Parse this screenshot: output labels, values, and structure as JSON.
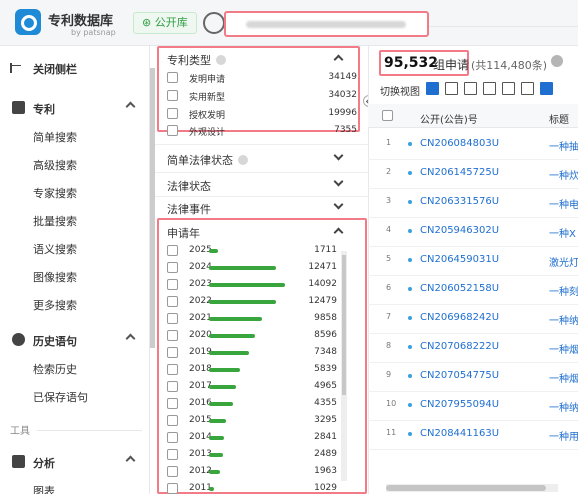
{
  "header": {
    "app_name": "专利数据库",
    "app_sub": "by patsnap",
    "public_button": "公开库"
  },
  "nav": {
    "collapse_label": "关闭侧栏",
    "groups": [
      {
        "label": "专利",
        "items": [
          "简单搜索",
          "高级搜索",
          "专家搜索",
          "批量搜索",
          "语义搜索",
          "图像搜索",
          "更多搜索"
        ]
      },
      {
        "label": "历史语句",
        "items": [
          "检索历史",
          "已保存语句"
        ]
      }
    ],
    "section_label": "工具",
    "analysis_label": "分析",
    "analysis_first": "图表"
  },
  "filters": {
    "patent_type": {
      "title": "专利类型",
      "rows": [
        {
          "label": "发明申请",
          "count": "34149"
        },
        {
          "label": "实用新型",
          "count": "34032"
        },
        {
          "label": "授权发明",
          "count": "19996"
        },
        {
          "label": "外观设计",
          "count": "7355"
        }
      ]
    },
    "simple_status": "简单法律状态",
    "legal_status": "法律状态",
    "legal_event": "法律事件",
    "app_year": {
      "title": "申请年",
      "rows": [
        {
          "year": "2025",
          "count": "1711",
          "share": 0.12
        },
        {
          "year": "2024",
          "count": "12471",
          "share": 0.88
        },
        {
          "year": "2023",
          "count": "14092",
          "share": 1.0
        },
        {
          "year": "2022",
          "count": "12479",
          "share": 0.88
        },
        {
          "year": "2021",
          "count": "9858",
          "share": 0.7
        },
        {
          "year": "2020",
          "count": "8596",
          "share": 0.61
        },
        {
          "year": "2019",
          "count": "7348",
          "share": 0.52
        },
        {
          "year": "2018",
          "count": "5839",
          "share": 0.41
        },
        {
          "year": "2017",
          "count": "4965",
          "share": 0.35
        },
        {
          "year": "2016",
          "count": "4355",
          "share": 0.31
        },
        {
          "year": "2015",
          "count": "3295",
          "share": 0.23
        },
        {
          "year": "2014",
          "count": "2841",
          "share": 0.2
        },
        {
          "year": "2013",
          "count": "2489",
          "share": 0.18
        },
        {
          "year": "2012",
          "count": "1963",
          "share": 0.14
        },
        {
          "year": "2011",
          "count": "1029",
          "share": 0.07
        }
      ]
    }
  },
  "results": {
    "count": "95,532",
    "unit": "组申请",
    "total": "(共114,480条)",
    "view_label": "切换视图",
    "columns": {
      "number": "公开(公告)号",
      "title": "标题"
    },
    "rows": [
      {
        "n": "1",
        "id": "CN206084803U",
        "title": "一种抽"
      },
      {
        "n": "2",
        "id": "CN206145725U",
        "title": "一种炊"
      },
      {
        "n": "3",
        "id": "CN206331576U",
        "title": "一种电"
      },
      {
        "n": "4",
        "id": "CN205946302U",
        "title": "一种X"
      },
      {
        "n": "5",
        "id": "CN206459031U",
        "title": "激光灯"
      },
      {
        "n": "6",
        "id": "CN206052158U",
        "title": "一种刻"
      },
      {
        "n": "7",
        "id": "CN206968242U",
        "title": "一种纳"
      },
      {
        "n": "8",
        "id": "CN207068222U",
        "title": "一种烟"
      },
      {
        "n": "9",
        "id": "CN207054775U",
        "title": "一种烟"
      },
      {
        "n": "10",
        "id": "CN207955094U",
        "title": "一种纳"
      },
      {
        "n": "11",
        "id": "CN208441163U",
        "title": "一种用"
      }
    ]
  }
}
